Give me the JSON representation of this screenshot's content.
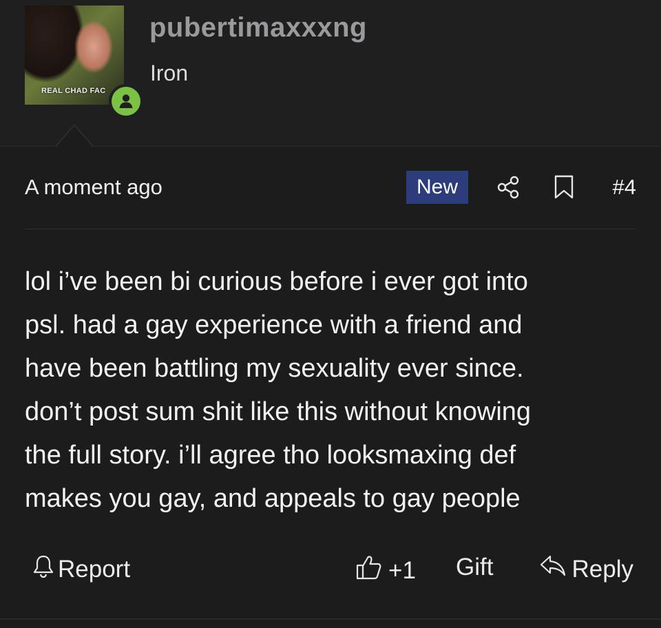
{
  "user": {
    "name": "pubertimaxxxng",
    "title": "Iron",
    "avatar_caption": "REAL CHAD FAC",
    "online_icon": "person-icon",
    "online_color": "#7bc143"
  },
  "post": {
    "timestamp": "A moment ago",
    "badge": "New",
    "badge_color": "#2d3d7c",
    "share_icon": "share-icon",
    "bookmark_icon": "bookmark-icon",
    "number": "#4",
    "body_lines": [
      "lol i’ve been bi curious before i ever got into",
      "psl. had a gay experience with a friend and",
      "have been battling my sexuality ever since.",
      "don’t post sum shit like this without knowing",
      "the full story. i’ll agree tho looksmaxing def",
      "makes you gay, and appeals to gay people"
    ]
  },
  "actions": {
    "report_label": "Report",
    "like_label": "+1",
    "gift_label": "Gift",
    "reply_label": "Reply",
    "icons": [
      "bell-icon",
      "thumbs-up-icon",
      "reply-arrow-icon"
    ]
  }
}
